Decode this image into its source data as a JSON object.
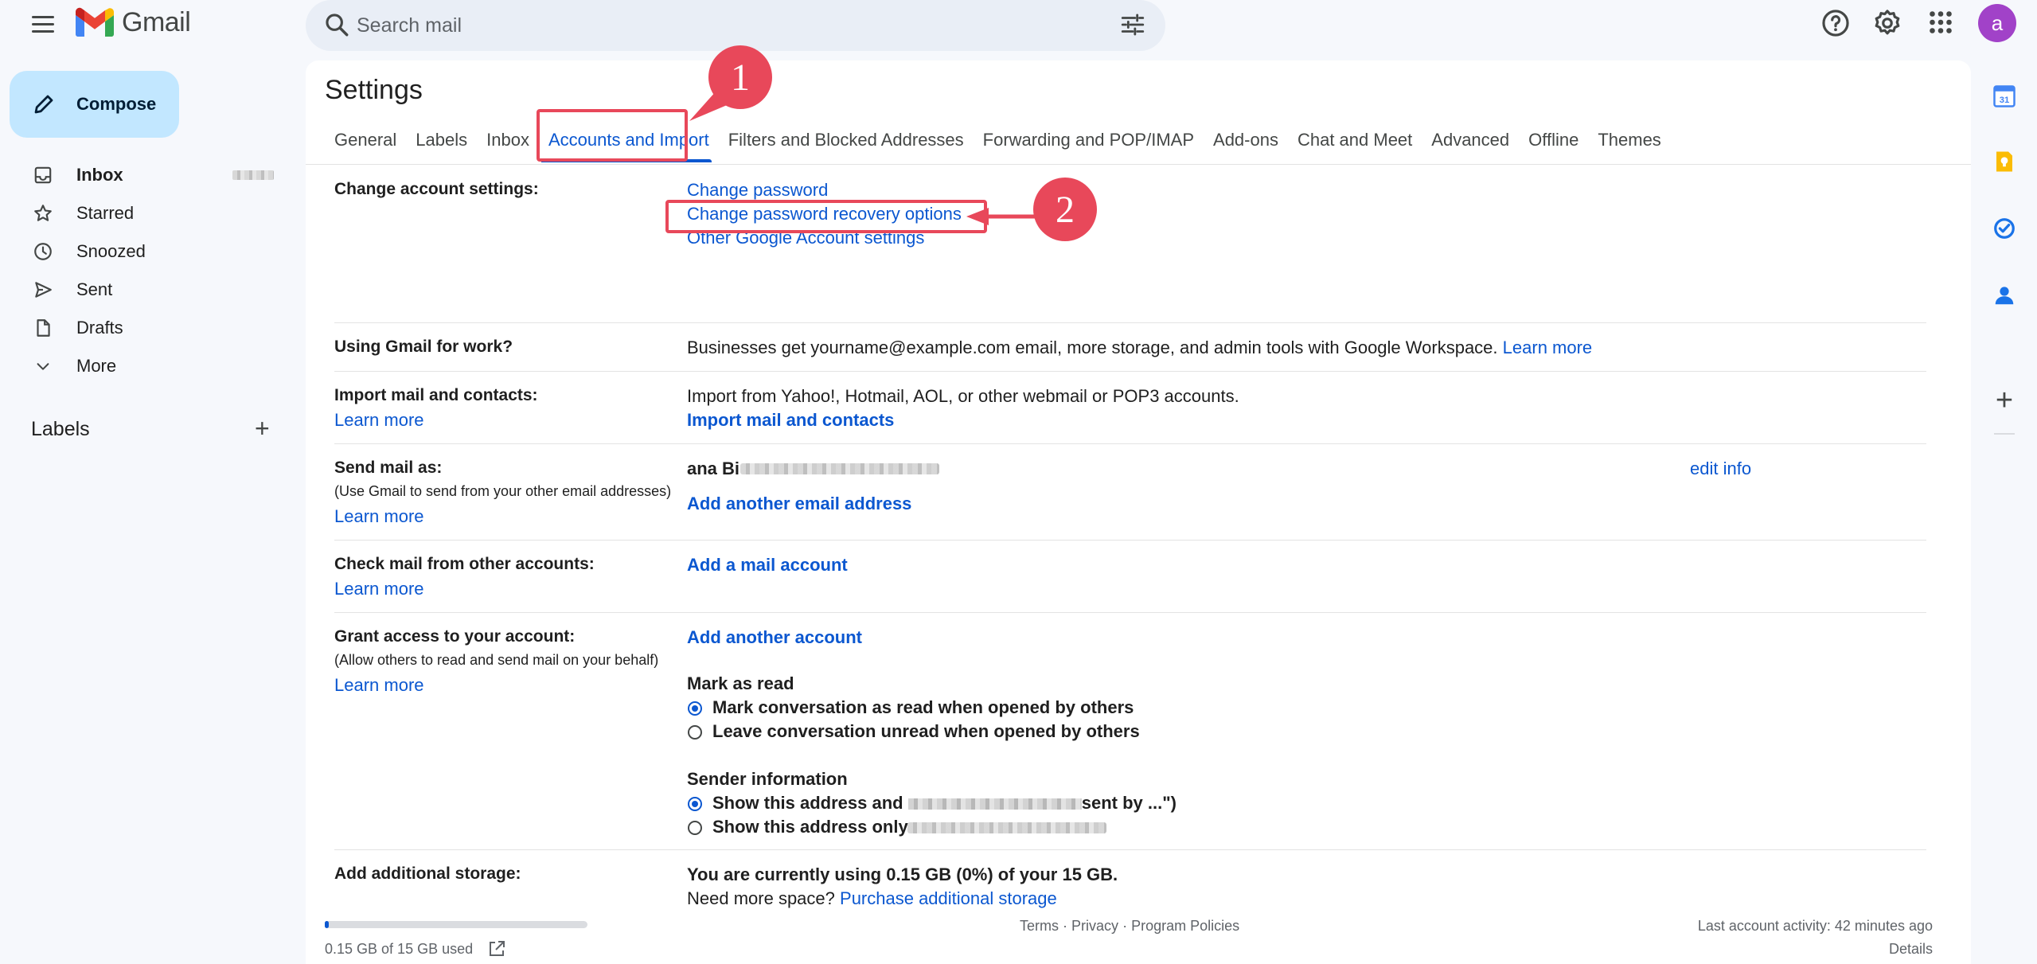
{
  "app": {
    "name": "Gmail"
  },
  "search": {
    "placeholder": "Search mail"
  },
  "user": {
    "avatar_letter": "a"
  },
  "compose": {
    "label": "Compose"
  },
  "nav": {
    "items": [
      {
        "label": "Inbox",
        "icon": "inbox-icon"
      },
      {
        "label": "Starred",
        "icon": "star-icon"
      },
      {
        "label": "Snoozed",
        "icon": "clock-icon"
      },
      {
        "label": "Sent",
        "icon": "send-icon"
      },
      {
        "label": "Drafts",
        "icon": "draft-icon"
      },
      {
        "label": "More",
        "icon": "chevron-down-icon"
      }
    ],
    "labels_heading": "Labels"
  },
  "settings": {
    "title": "Settings",
    "tabs": [
      "General",
      "Labels",
      "Inbox",
      "Accounts and Import",
      "Filters and Blocked Addresses",
      "Forwarding and POP/IMAP",
      "Add-ons",
      "Chat and Meet",
      "Advanced",
      "Offline",
      "Themes"
    ],
    "active_tab": "Accounts and Import",
    "change_account": {
      "label": "Change account settings:",
      "links": [
        "Change password",
        "Change password recovery options",
        "Other Google Account settings"
      ]
    },
    "work": {
      "label": "Using Gmail for work?",
      "text": "Businesses get yourname@example.com email, more storage, and admin tools with Google Workspace.",
      "link": "Learn more"
    },
    "import": {
      "label": "Import mail and contacts:",
      "learn_more": "Learn more",
      "text": "Import from Yahoo!, Hotmail, AOL, or other webmail or POP3 accounts.",
      "link": "Import mail and contacts"
    },
    "send_as": {
      "label": "Send mail as:",
      "sub": "(Use Gmail to send from your other email addresses)",
      "learn_more": "Learn more",
      "name": "ana Bi",
      "edit": "edit info",
      "add": "Add another email address"
    },
    "check_mail": {
      "label": "Check mail from other accounts:",
      "learn_more": "Learn more",
      "add": "Add a mail account"
    },
    "grant": {
      "label": "Grant access to your account:",
      "sub": "(Allow others to read and send mail on your behalf)",
      "learn_more": "Learn more",
      "add": "Add another account",
      "mark_read_heading": "Mark as read",
      "mark_read_options": [
        "Mark conversation as read when opened by others",
        "Leave conversation unread when opened by others"
      ],
      "sender_heading": "Sender information",
      "sender_option_1a": "Show this address and ",
      "sender_option_1b": "sent by ...\")",
      "sender_option_2": "Show this address only"
    },
    "storage": {
      "label": "Add additional storage:",
      "usage": "You are currently using 0.15 GB (0%) of your 15 GB.",
      "need_more": "Need more space?",
      "link": "Purchase additional storage"
    }
  },
  "footer": {
    "storage_used": "0.15 GB of 15 GB used",
    "storage_fraction": 0.01,
    "terms": "Terms",
    "privacy": "Privacy",
    "policies": "Program Policies",
    "sep": "·",
    "last_activity": "Last account activity: 42 minutes ago",
    "details": "Details"
  },
  "annotations": {
    "badge_1": "1",
    "badge_2": "2"
  },
  "colors": {
    "accent": "#0b57d0",
    "annotation": "#e8485a",
    "compose_bg": "#c2e7ff",
    "avatar": "#a142c8"
  }
}
